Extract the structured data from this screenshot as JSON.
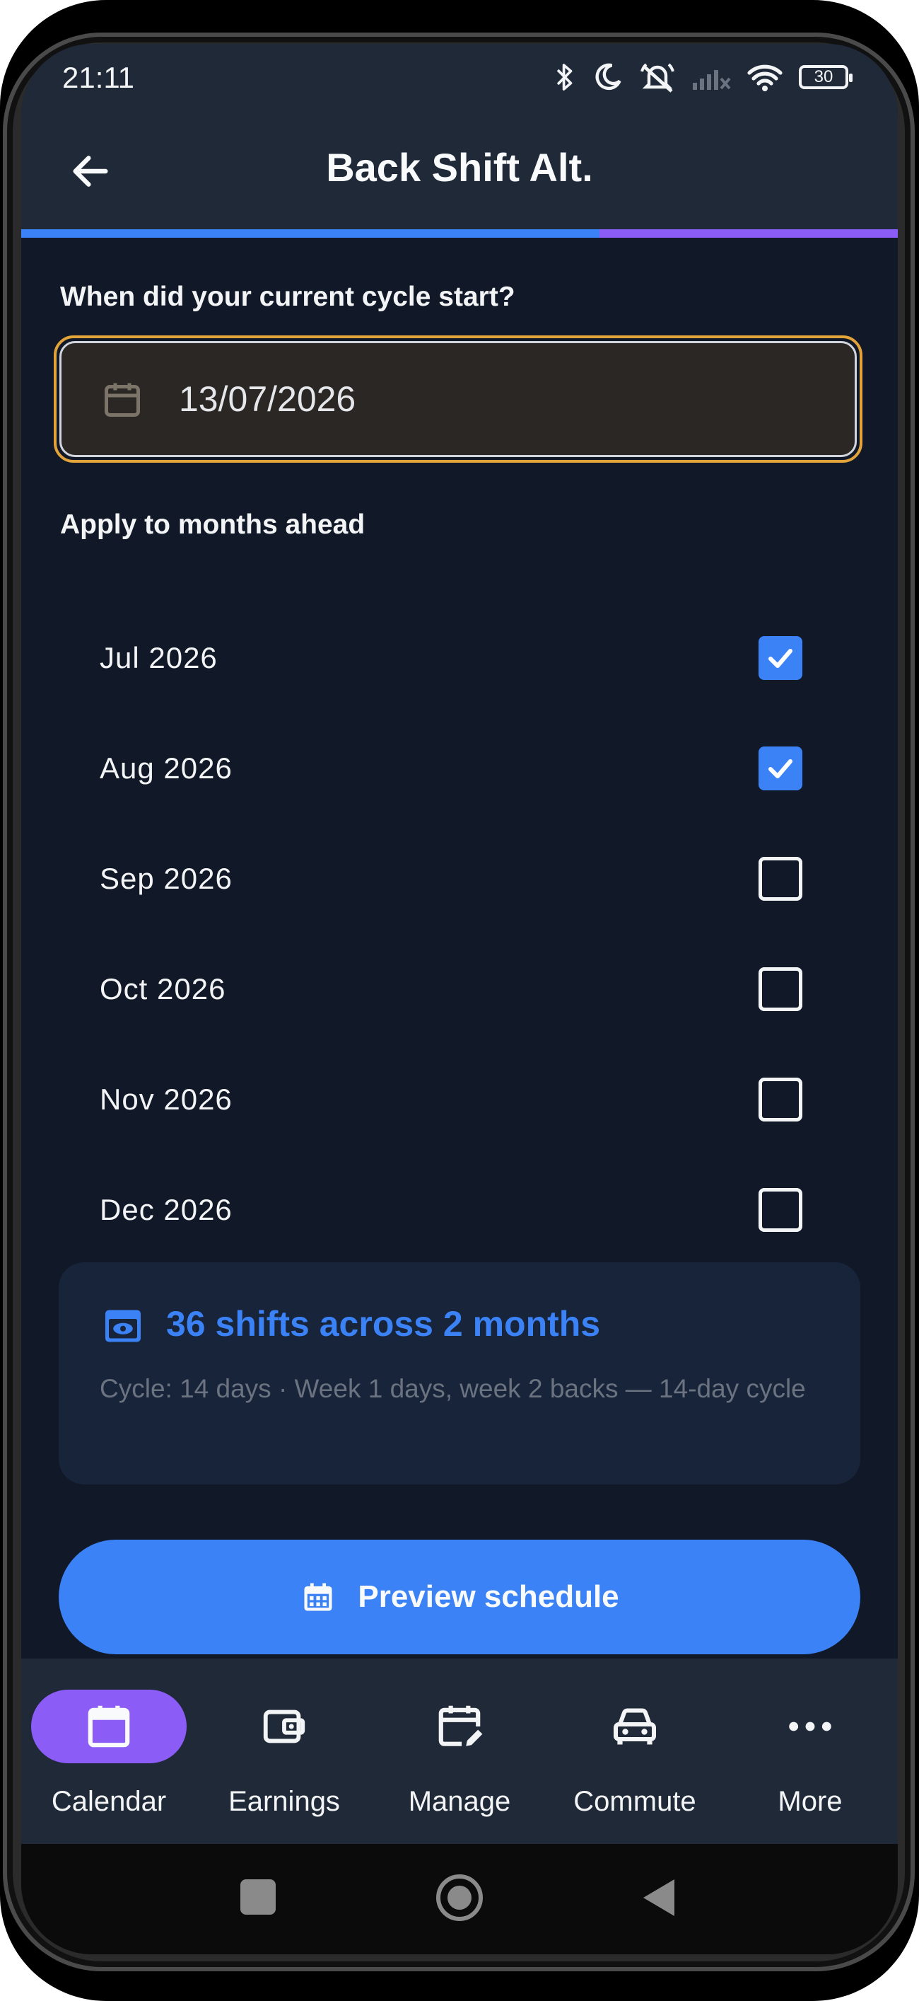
{
  "status_bar": {
    "time": "21:11",
    "battery": "30",
    "icons": [
      "bluetooth-icon",
      "moon-icon",
      "alarm-off-icon",
      "signal-icon",
      "wifi-icon",
      "battery-icon"
    ]
  },
  "app_bar": {
    "title": "Back Shift Alt.",
    "back_icon": "arrow-left-icon",
    "progress_fraction": 0.66,
    "colors": {
      "bar_bg": "#1f2937",
      "progress_fill": "#3b82f6",
      "progress_track": "#8b5cf6"
    }
  },
  "cycle_start": {
    "label": "When did your current cycle start?",
    "value": "13/07/2026",
    "icon": "calendar-icon",
    "focus_color": "#e2a33a"
  },
  "months": {
    "label": "Apply to months ahead",
    "items": [
      {
        "label": "Jul 2026",
        "checked": true
      },
      {
        "label": "Aug 2026",
        "checked": true
      },
      {
        "label": "Sep 2026",
        "checked": false
      },
      {
        "label": "Oct 2026",
        "checked": false
      },
      {
        "label": "Nov 2026",
        "checked": false
      },
      {
        "label": "Dec 2026",
        "checked": false
      }
    ]
  },
  "summary": {
    "icon": "preview-icon",
    "title": "36 shifts across 2 months",
    "description": "Cycle: 14 days · Week 1 days, week 2 backs — 14-day cycle"
  },
  "actions": {
    "preview_label": "Preview schedule",
    "preview_icon": "calendar-grid-icon",
    "accent": "#3b82f6"
  },
  "bottom_nav": {
    "active_color": "#8b5cf6",
    "items": [
      {
        "label": "Calendar",
        "icon": "calendar-icon",
        "active": true
      },
      {
        "label": "Earnings",
        "icon": "wallet-icon",
        "active": false
      },
      {
        "label": "Manage",
        "icon": "calendar-edit-icon",
        "active": false
      },
      {
        "label": "Commute",
        "icon": "car-icon",
        "active": false
      },
      {
        "label": "More",
        "icon": "more-horizontal-icon",
        "active": false
      }
    ]
  },
  "system_nav": {
    "buttons": [
      "recents-button",
      "home-button",
      "back-button"
    ]
  }
}
